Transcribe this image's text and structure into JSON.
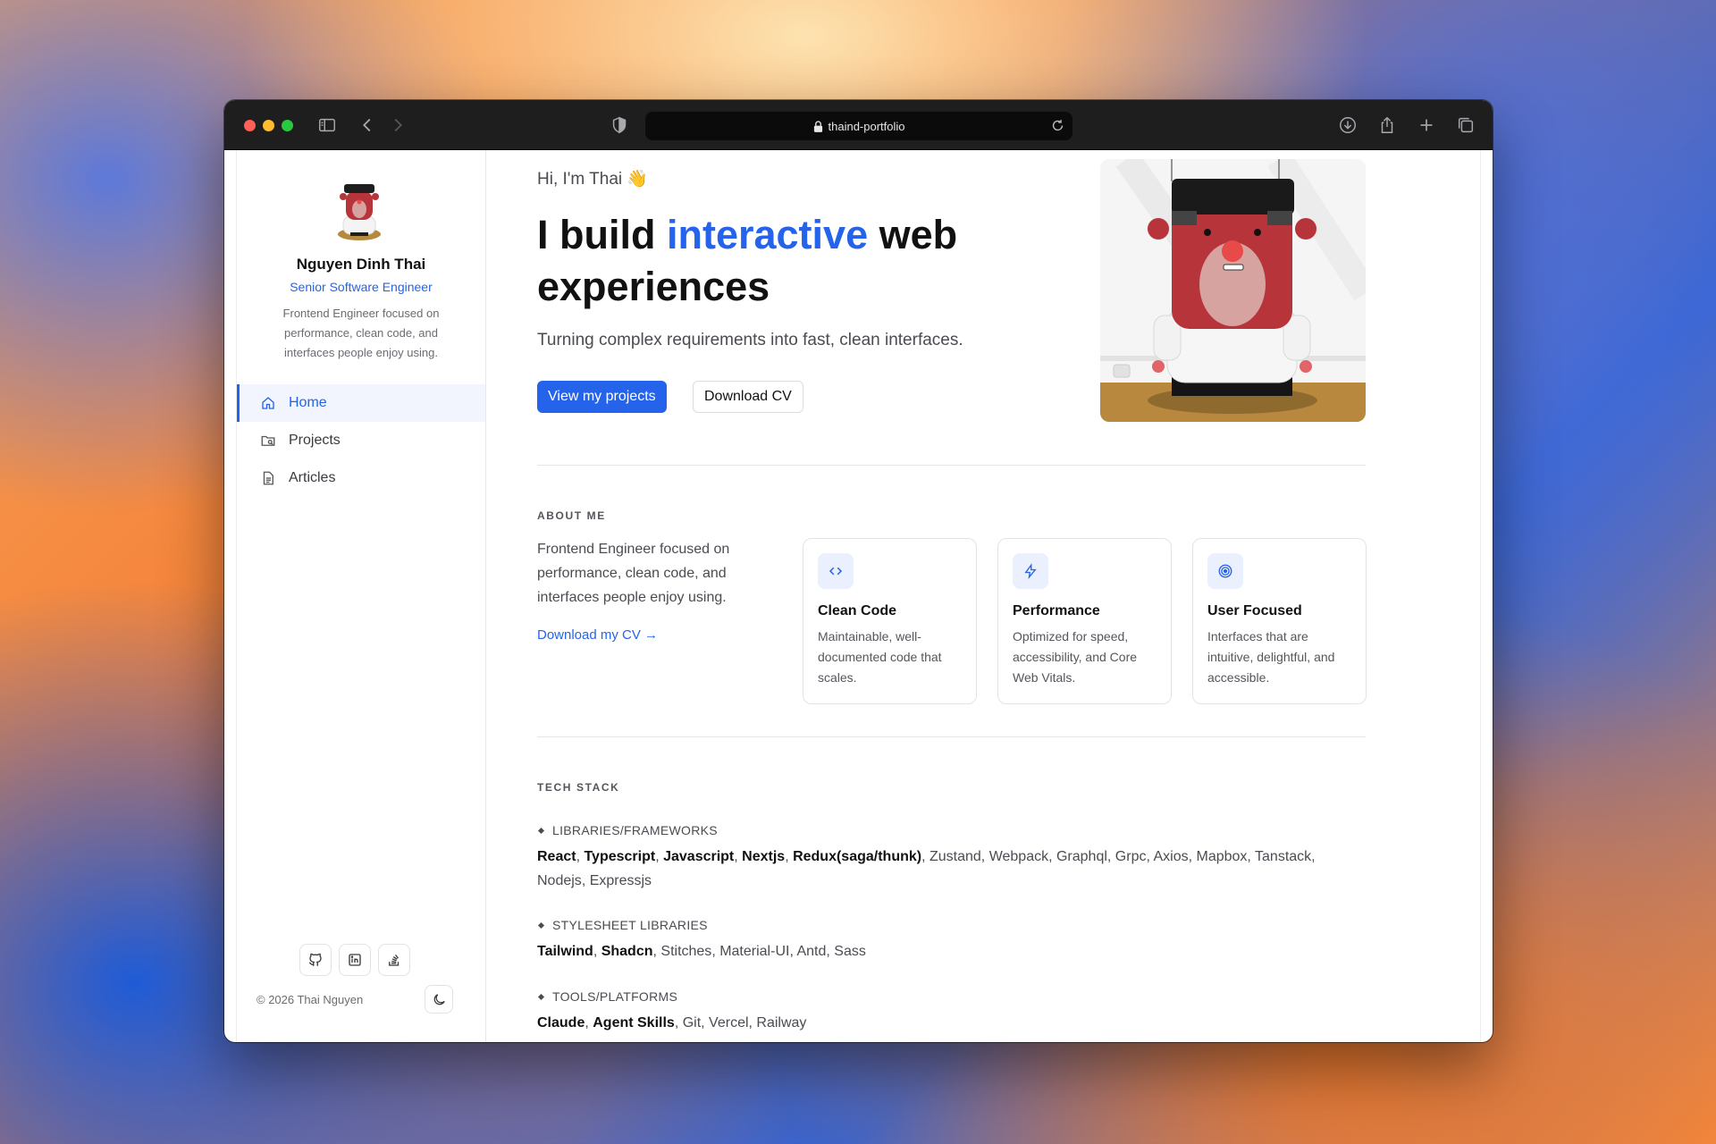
{
  "browser": {
    "url": "thaind-portfolio"
  },
  "sidebar": {
    "name": "Nguyen Dinh Thai",
    "role": "Senior Software Engineer",
    "description": "Frontend Engineer focused on performance, clean code, and interfaces people enjoy using.",
    "nav": [
      {
        "label": "Home",
        "icon": "home-icon",
        "active": true
      },
      {
        "label": "Projects",
        "icon": "folder-icon",
        "active": false
      },
      {
        "label": "Articles",
        "icon": "document-icon",
        "active": false
      }
    ],
    "socials": [
      "github-icon",
      "linkedin-icon",
      "stackoverflow-icon"
    ],
    "copyright": "© 2026 Thai Nguyen",
    "theme_icon": "moon-icon"
  },
  "hero": {
    "greeting": "Hi, I'm Thai 👋",
    "headline_pre": "I build ",
    "headline_accent": "interactive",
    "headline_post": " web experiences",
    "tagline": "Turning complex requirements into fast, clean interfaces.",
    "primary_button": "View my projects",
    "secondary_button": "Download CV"
  },
  "about": {
    "label": "ABOUT ME",
    "text": "Frontend Engineer focused on performance, clean code, and interfaces people enjoy using.",
    "link": "Download my CV →",
    "cards": [
      {
        "icon": "code-icon",
        "title": "Clean Code",
        "desc": "Maintainable, well-documented code that scales."
      },
      {
        "icon": "lightning-icon",
        "title": "Performance",
        "desc": "Optimized for speed, accessibility, and Core Web Vitals."
      },
      {
        "icon": "target-icon",
        "title": "User Focused",
        "desc": "Interfaces that are intuitive, delightful, and accessible."
      }
    ]
  },
  "tech": {
    "label": "TECH STACK",
    "groups": [
      {
        "title": "LIBRARIES/FRAMEWORKS",
        "bold": [
          "React",
          "Typescript",
          "Javascript",
          "Nextjs",
          "Redux(saga/thunk)"
        ],
        "rest": [
          "Zustand",
          "Webpack",
          "Graphql",
          "Grpc",
          "Axios",
          "Mapbox",
          "Tanstack",
          "Nodejs",
          "Expressjs"
        ]
      },
      {
        "title": "STYLESHEET LIBRARIES",
        "bold": [
          "Tailwind",
          "Shadcn"
        ],
        "rest": [
          "Stitches",
          "Material-UI",
          "Antd",
          "Sass"
        ]
      },
      {
        "title": "TOOLS/PLATFORMS",
        "bold": [
          "Claude",
          "Agent Skills"
        ],
        "rest": [
          "Git",
          "Vercel",
          "Railway"
        ]
      }
    ]
  }
}
